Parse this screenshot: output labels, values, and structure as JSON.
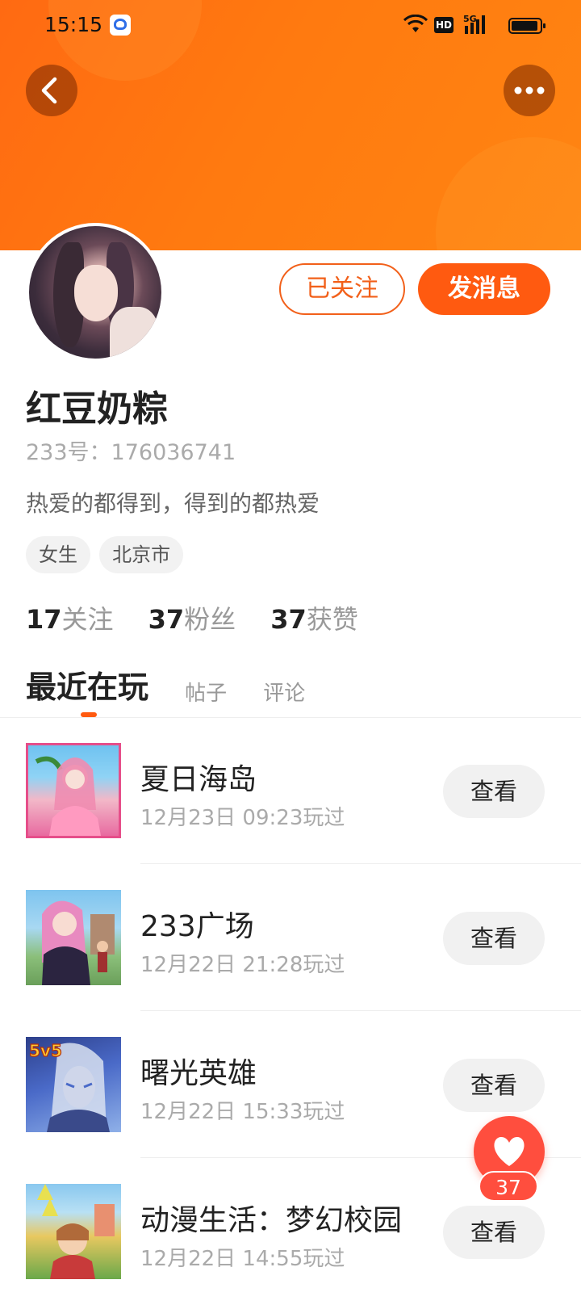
{
  "status_bar": {
    "time": "15:15",
    "hd": "HD",
    "network": "5G"
  },
  "header": {
    "back_icon": "chevron-left-icon",
    "more_icon": "more-horizontal-icon",
    "bg_color": "#ff7412"
  },
  "profile": {
    "followed_label": "已关注",
    "message_label": "发消息",
    "name": "红豆奶粽",
    "id_text": "233号：176036741",
    "bio": "热爱的都得到，得到的都热爱",
    "tags": [
      "女生",
      "北京市"
    ],
    "stats": [
      {
        "num": "17",
        "label": "关注"
      },
      {
        "num": "37",
        "label": "粉丝"
      },
      {
        "num": "37",
        "label": "获赞"
      }
    ]
  },
  "tabs": {
    "items": [
      "最近在玩",
      "帖子",
      "评论"
    ],
    "active": "最近在玩"
  },
  "games": [
    {
      "title": "夏日海岛",
      "time": "12月23日 09:23玩过",
      "button": "查看"
    },
    {
      "title": "233广场",
      "time": "12月22日 21:28玩过",
      "button": "查看"
    },
    {
      "title": "曙光英雄",
      "time": "12月22日 15:33玩过",
      "button": "查看",
      "badge": "5v5"
    },
    {
      "title": "动漫生活：梦幻校园",
      "time": "12月22日 14:55玩过",
      "button": "查看"
    }
  ],
  "like_fab": {
    "icon": "heart-icon",
    "count": "37"
  },
  "colors": {
    "accent": "#ff5a10",
    "like": "#ff4e3e"
  }
}
